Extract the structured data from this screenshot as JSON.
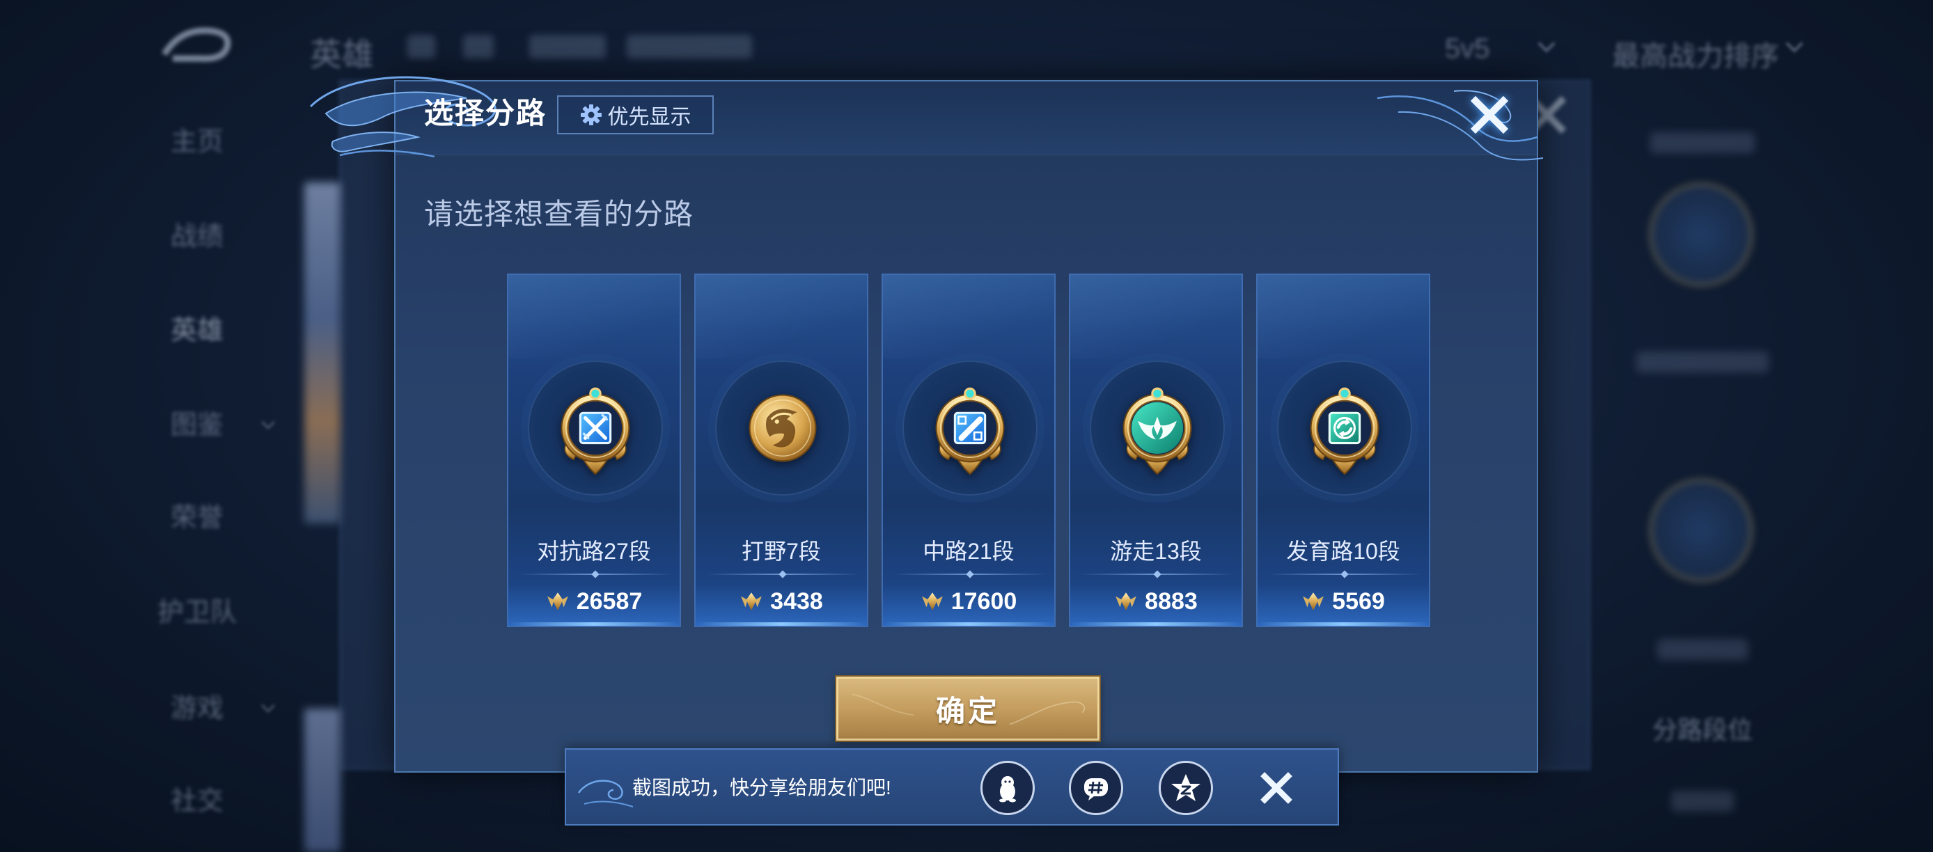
{
  "background": {
    "top_bar": {
      "title": "英雄",
      "mode": "5v5",
      "sort": "最高战力排序"
    },
    "sidebar": {
      "items": [
        {
          "label": "主页"
        },
        {
          "label": "战绩"
        },
        {
          "label": "英雄"
        },
        {
          "label": "图鉴"
        },
        {
          "label": "荣誉"
        },
        {
          "label": "护卫队"
        },
        {
          "label": "游戏"
        },
        {
          "label": "社交"
        }
      ]
    },
    "right_panel": {
      "lane_rank_label": "分路段位"
    }
  },
  "modal": {
    "title": "选择分路",
    "priority_button": {
      "label": "优先显示",
      "icon": "gear-icon"
    },
    "prompt": "请选择想查看的分路",
    "lanes": [
      {
        "label": "对抗路27段",
        "score": "26587",
        "emblem": "clash-lane-emblem-icon"
      },
      {
        "label": "打野7段",
        "score": "3438",
        "emblem": "jungle-emblem-icon"
      },
      {
        "label": "中路21段",
        "score": "17600",
        "emblem": "mid-lane-emblem-icon"
      },
      {
        "label": "游走13段",
        "score": "8883",
        "emblem": "roam-emblem-icon"
      },
      {
        "label": "发育路10段",
        "score": "5569",
        "emblem": "farm-lane-emblem-icon"
      }
    ],
    "confirm_label": "确定",
    "close_icon": "close-icon"
  },
  "share_bar": {
    "message": "截图成功，快分享给朋友们吧!",
    "targets": [
      {
        "icon": "qq-icon"
      },
      {
        "icon": "moments-icon"
      },
      {
        "icon": "qzone-icon"
      }
    ],
    "close_icon": "close-icon"
  },
  "colors": {
    "accent_gold": "#c9a468",
    "panel_blue": "#2a4369",
    "card_border": "#3f6cb0",
    "text_light": "#e3ecff"
  }
}
